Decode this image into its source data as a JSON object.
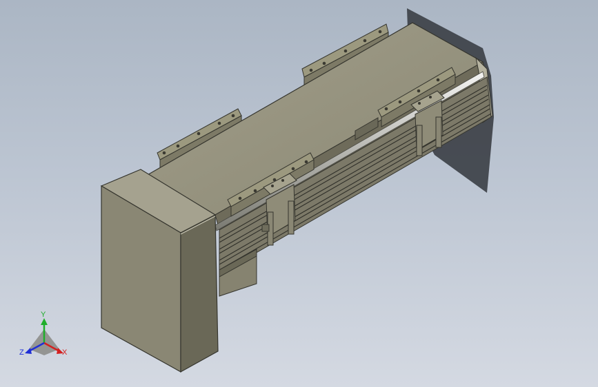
{
  "viewport": {
    "background_top": "#abb6c4",
    "background_bottom": "#d4d9e2",
    "model_color": "#8f8c78",
    "shadow_color": "#3d4148"
  },
  "triad": {
    "x_label": "X",
    "y_label": "Y",
    "z_label": "Z",
    "x_color": "#d42020",
    "y_color": "#1fae2a",
    "z_color": "#1f2fd6"
  }
}
